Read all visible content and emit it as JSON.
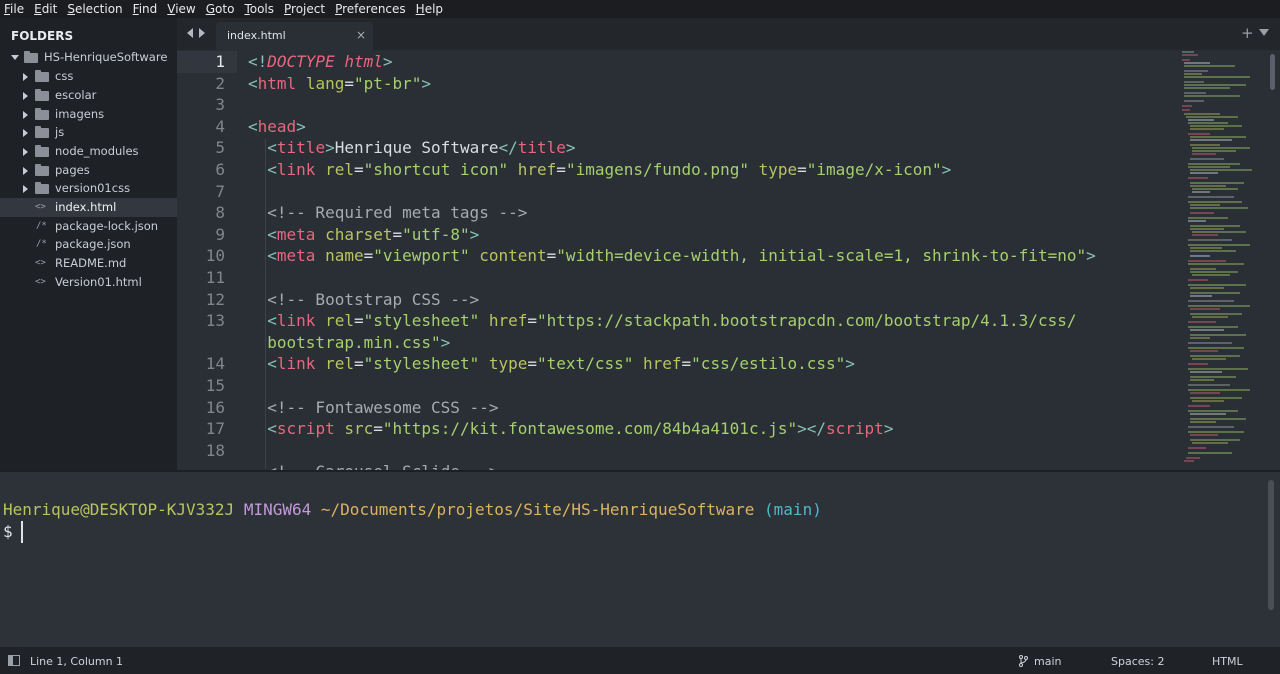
{
  "menu": [
    "File",
    "Edit",
    "Selection",
    "Find",
    "View",
    "Goto",
    "Tools",
    "Project",
    "Preferences",
    "Help"
  ],
  "sidebar": {
    "header": "FOLDERS",
    "root": "HS-HenriqueSoftware",
    "folders": [
      "css",
      "escolar",
      "imagens",
      "js",
      "node_modules",
      "pages",
      "version01css"
    ],
    "files": [
      {
        "icon": "<>",
        "name": "index.html",
        "active": true
      },
      {
        "icon": "/*",
        "name": "package-lock.json"
      },
      {
        "icon": "/*",
        "name": "package.json"
      },
      {
        "icon": "<>",
        "name": "README.md"
      },
      {
        "icon": "<>",
        "name": "Version01.html"
      }
    ]
  },
  "tabs": {
    "active_label": "index.html",
    "close_glyph": "×",
    "add_glyph": "+"
  },
  "editor": {
    "line_numbers": [
      "1",
      "2",
      "3",
      "4",
      "5",
      "6",
      "7",
      "8",
      "9",
      "10",
      "11",
      "12",
      "13",
      "14",
      "15",
      "16",
      "17",
      "18"
    ],
    "current_line": 1
  },
  "terminal": {
    "user": "Henrique@DESKTOP-KJV332J",
    "system": "MINGW64",
    "path": "~/Documents/projetos/Site/HS-HenriqueSoftware",
    "branch": "(main)",
    "prompt_symbol": "$"
  },
  "status": {
    "position": "Line 1, Column 1",
    "branch": "main",
    "spaces": "Spaces: 2",
    "syntax": "HTML"
  },
  "colors": {
    "tag": "#e9677e",
    "attribute": "#b7c45f",
    "string": "#a5d06d",
    "punctuation": "#88c1b6",
    "comment": "#a4abb3"
  }
}
